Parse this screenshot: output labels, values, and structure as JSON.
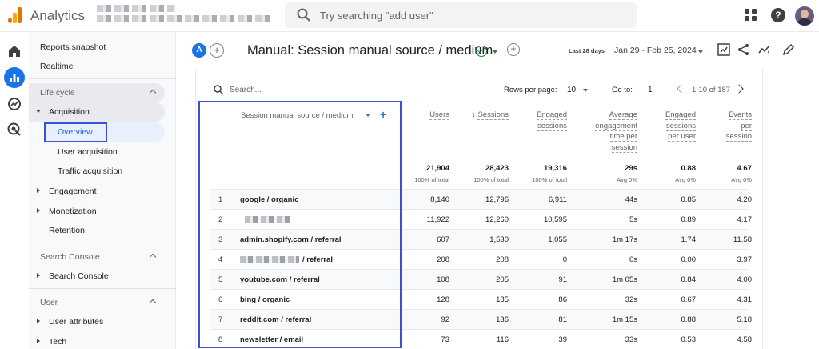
{
  "app": {
    "title": "Analytics"
  },
  "search": {
    "placeholder": "Try searching \"add user\""
  },
  "nav": {
    "reports_snapshot": "Reports snapshot",
    "realtime": "Realtime",
    "life_cycle": "Life cycle",
    "acquisition": "Acquisition",
    "overview": "Overview",
    "user_acquisition": "User acquisition",
    "traffic_acquisition": "Traffic acquisition",
    "engagement": "Engagement",
    "monetization": "Monetization",
    "retention": "Retention",
    "search_console_section": "Search Console",
    "search_console": "Search Console",
    "user_section": "User",
    "user_attributes": "User attributes",
    "tech": "Tech"
  },
  "header": {
    "comparison_letter": "A",
    "title": "Manual: Session manual source / medium",
    "date_label": "Last 28 days",
    "date_range": "Jan 29 - Feb 25, 2024"
  },
  "toolbar": {
    "search_placeholder": "Search...",
    "rows_per_page_label": "Rows per page:",
    "rows_per_page_value": "10",
    "goto_label": "Go to:",
    "goto_value": "1",
    "pager_text": "1-10 of 187"
  },
  "table": {
    "dimension_header": "Session manual source / medium",
    "columns": [
      {
        "lines": [
          "Users"
        ],
        "total": "21,904",
        "sub": "100% of total"
      },
      {
        "lines": [
          "Sessions"
        ],
        "total": "28,423",
        "sub": "100% of total",
        "sorted": true
      },
      {
        "lines": [
          "Engaged",
          "sessions"
        ],
        "total": "19,316",
        "sub": "100% of total"
      },
      {
        "lines": [
          "Average",
          "engagement",
          "time per",
          "session"
        ],
        "total": "29s",
        "sub": "Avg 0%"
      },
      {
        "lines": [
          "Engaged",
          "sessions",
          "per user"
        ],
        "total": "0.88",
        "sub": "Avg 0%"
      },
      {
        "lines": [
          "Events",
          "per",
          "session"
        ],
        "total": "4.67",
        "sub": "Avg 0%"
      }
    ],
    "rows": [
      {
        "idx": "1",
        "dim": "google / organic",
        "vals": [
          "8,140",
          "12,796",
          "6,911",
          "44s",
          "0.85",
          "4.20"
        ]
      },
      {
        "idx": "2",
        "dim": "",
        "vals": [
          "11,922",
          "12,260",
          "10,595",
          "5s",
          "0.89",
          "4.17"
        ]
      },
      {
        "idx": "3",
        "dim": "admin.shopify.com / referral",
        "vals": [
          "607",
          "1,530",
          "1,055",
          "1m 17s",
          "1.74",
          "11.58"
        ]
      },
      {
        "idx": "4",
        "dim": "/ referral",
        "vals": [
          "208",
          "208",
          "0",
          "0s",
          "0.00",
          "3.97"
        ]
      },
      {
        "idx": "5",
        "dim": "youtube.com / referral",
        "vals": [
          "108",
          "205",
          "91",
          "1m 05s",
          "0.84",
          "4.00"
        ]
      },
      {
        "idx": "6",
        "dim": "bing / organic",
        "vals": [
          "128",
          "185",
          "86",
          "32s",
          "0.67",
          "4.31"
        ]
      },
      {
        "idx": "7",
        "dim": "reddit.com / referral",
        "vals": [
          "92",
          "136",
          "81",
          "1m 15s",
          "0.88",
          "5.18"
        ]
      },
      {
        "idx": "8",
        "dim": "newsletter / email",
        "vals": [
          "73",
          "116",
          "39",
          "33s",
          "0.53",
          "4.58"
        ]
      }
    ]
  }
}
